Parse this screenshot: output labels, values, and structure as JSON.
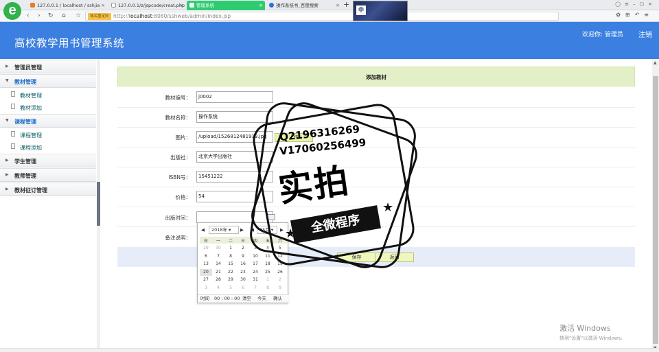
{
  "browser": {
    "logo": "e",
    "tabs": [
      {
        "label": "127.0.0.1 / localhost / sshjia"
      },
      {
        "label": "127.0.0.1/z/jspcode/creat.php"
      },
      {
        "label": "管理系统"
      },
      {
        "label": "操作系统书_百度搜索"
      }
    ],
    "new_tab": "+",
    "avatar_text": "中",
    "domain_tag": "域名重定向",
    "url_prefix": "http://",
    "url_host": "localhost",
    "url_rest": ":8080/sshweb/admin/index.jsp",
    "accent_color": "#2ecc71"
  },
  "header": {
    "title": "高校教学用书管理系统",
    "welcome": "欢迎你: 管理员",
    "logout": "注销",
    "bg_color": "#3b7fe0"
  },
  "sidebar": {
    "groups": [
      {
        "label": "管理员管理",
        "open": false,
        "items": []
      },
      {
        "label": "教材管理",
        "open": true,
        "items": [
          "教材管理",
          "教材添加"
        ]
      },
      {
        "label": "课程管理",
        "open": true,
        "items": [
          "课程管理",
          "课程添加"
        ]
      },
      {
        "label": "学生管理",
        "open": false,
        "items": []
      },
      {
        "label": "教师管理",
        "open": false,
        "items": []
      },
      {
        "label": "教材征订管理",
        "open": false,
        "items": []
      }
    ]
  },
  "form": {
    "title": "添加教材",
    "fields": {
      "code": {
        "label": "教材编号：",
        "value": "j0002"
      },
      "name": {
        "label": "教材名称：",
        "value": "操作系统"
      },
      "image": {
        "label": "图片：",
        "value": "/upload/1526812481913.jpg"
      },
      "publisher": {
        "label": "出版社：",
        "value": "北京大学出版社"
      },
      "isbn": {
        "label": "ISBN号：",
        "value": "15451222"
      },
      "price": {
        "label": "价格：",
        "value": "54"
      },
      "pub_date": {
        "label": "出版时间：",
        "value": ""
      },
      "remark": {
        "label": "备注说明：",
        "value": ""
      }
    },
    "upload_label": "上传",
    "save_label": "保存",
    "back_label": "返回"
  },
  "datepicker": {
    "year": "2018年",
    "month": "05月",
    "weekdays": [
      "日",
      "一",
      "二",
      "三",
      "四",
      "五",
      "六"
    ],
    "weeks": [
      [
        "29",
        "30",
        "1",
        "2",
        "3",
        "4",
        "5"
      ],
      [
        "6",
        "7",
        "8",
        "9",
        "10",
        "11",
        "12"
      ],
      [
        "13",
        "14",
        "15",
        "16",
        "17",
        "18",
        "19"
      ],
      [
        "20",
        "21",
        "22",
        "23",
        "24",
        "25",
        "26"
      ],
      [
        "27",
        "28",
        "29",
        "30",
        "31",
        "1",
        "2"
      ],
      [
        "3",
        "4",
        "5",
        "6",
        "7",
        "8",
        "9"
      ]
    ],
    "time_label": "时间",
    "time_value": "00 : 00 : 00",
    "clear_label": "清空",
    "today_label": "今天",
    "ok_label": "确认"
  },
  "watermark": {
    "line1": "Q2196316269",
    "line2": "V17060256499",
    "big": "实拍",
    "ribbon": "全微程序"
  },
  "windows": {
    "activate_title": "激活 Windows",
    "activate_hint": "转到\"设置\"以激活 Windows。"
  }
}
